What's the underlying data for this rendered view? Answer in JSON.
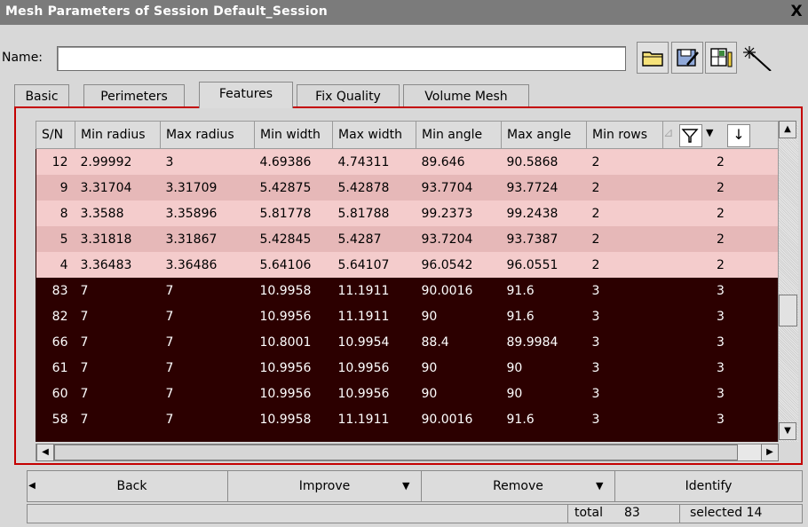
{
  "window": {
    "title": "Mesh Parameters of Session Default_Session",
    "close_label": "X"
  },
  "name": {
    "label": "Name:",
    "value": ""
  },
  "toolbar": {
    "icons": [
      "folder-icon",
      "save-icon",
      "grid-edit-icon",
      "magic-wand-icon"
    ]
  },
  "tabs": [
    {
      "label": "Basic"
    },
    {
      "label": "Perimeters"
    },
    {
      "label": "Features"
    },
    {
      "label": "Fix Quality"
    },
    {
      "label": "Volume Mesh"
    }
  ],
  "active_tab": "Features",
  "table": {
    "columns": [
      "S/N",
      "Min radius",
      "Max radius",
      "Min width",
      "Max width",
      "Min angle",
      "Max angle",
      "Min rows"
    ],
    "extra_header": {
      "sort_indicator": "⊿",
      "filter_icon": "filter-icon",
      "dropdown_icon": "chevron-down-icon",
      "sort_icon": "arrow-down-icon"
    },
    "rows": [
      {
        "sn": "12",
        "min_radius": "2.99992",
        "max_radius": "3",
        "min_width": "4.69386",
        "max_width": "4.74311",
        "min_angle": "89.646",
        "max_angle": "90.5868",
        "min_rows": "2",
        "extra": "2",
        "style": "pink1"
      },
      {
        "sn": "9",
        "min_radius": "3.31704",
        "max_radius": "3.31709",
        "min_width": "5.42875",
        "max_width": "5.42878",
        "min_angle": "93.7704",
        "max_angle": "93.7724",
        "min_rows": "2",
        "extra": "2",
        "style": "pink2"
      },
      {
        "sn": "8",
        "min_radius": "3.3588",
        "max_radius": "3.35896",
        "min_width": "5.81778",
        "max_width": "5.81788",
        "min_angle": "99.2373",
        "max_angle": "99.2438",
        "min_rows": "2",
        "extra": "2",
        "style": "pink1"
      },
      {
        "sn": "5",
        "min_radius": "3.31818",
        "max_radius": "3.31867",
        "min_width": "5.42845",
        "max_width": "5.4287",
        "min_angle": "93.7204",
        "max_angle": "93.7387",
        "min_rows": "2",
        "extra": "2",
        "style": "pink2"
      },
      {
        "sn": "4",
        "min_radius": "3.36483",
        "max_radius": "3.36486",
        "min_width": "5.64106",
        "max_width": "5.64107",
        "min_angle": "96.0542",
        "max_angle": "96.0551",
        "min_rows": "2",
        "extra": "2",
        "style": "pink1"
      },
      {
        "sn": "83",
        "min_radius": "7",
        "max_radius": "7",
        "min_width": "10.9958",
        "max_width": "11.1911",
        "min_angle": "90.0016",
        "max_angle": "91.6",
        "min_rows": "3",
        "extra": "3",
        "style": "dark"
      },
      {
        "sn": "82",
        "min_radius": "7",
        "max_radius": "7",
        "min_width": "10.9956",
        "max_width": "11.1911",
        "min_angle": "90",
        "max_angle": "91.6",
        "min_rows": "3",
        "extra": "3",
        "style": "dark"
      },
      {
        "sn": "66",
        "min_radius": "7",
        "max_radius": "7",
        "min_width": "10.8001",
        "max_width": "10.9954",
        "min_angle": "88.4",
        "max_angle": "89.9984",
        "min_rows": "3",
        "extra": "3",
        "style": "dark"
      },
      {
        "sn": "61",
        "min_radius": "7",
        "max_radius": "7",
        "min_width": "10.9956",
        "max_width": "10.9956",
        "min_angle": "90",
        "max_angle": "90",
        "min_rows": "3",
        "extra": "3",
        "style": "dark"
      },
      {
        "sn": "60",
        "min_radius": "7",
        "max_radius": "7",
        "min_width": "10.9956",
        "max_width": "10.9956",
        "min_angle": "90",
        "max_angle": "90",
        "min_rows": "3",
        "extra": "3",
        "style": "dark"
      },
      {
        "sn": "58",
        "min_radius": "7",
        "max_radius": "7",
        "min_width": "10.9958",
        "max_width": "11.1911",
        "min_angle": "90.0016",
        "max_angle": "91.6",
        "min_rows": "3",
        "extra": "3",
        "style": "dark"
      }
    ]
  },
  "bottom_buttons": [
    {
      "label": "Back",
      "has_dropdown": false
    },
    {
      "label": "Improve",
      "has_dropdown": true
    },
    {
      "label": "Remove",
      "has_dropdown": true
    },
    {
      "label": "Identify",
      "has_dropdown": false
    }
  ],
  "status": {
    "total_label": "total",
    "total_value": "83",
    "selected": "selected 14"
  },
  "colors": {
    "panel_border": "#c40000",
    "selected_row": "#f4cccc",
    "dark_row": "#2c0000",
    "title_bar": "#7b7b7b"
  }
}
